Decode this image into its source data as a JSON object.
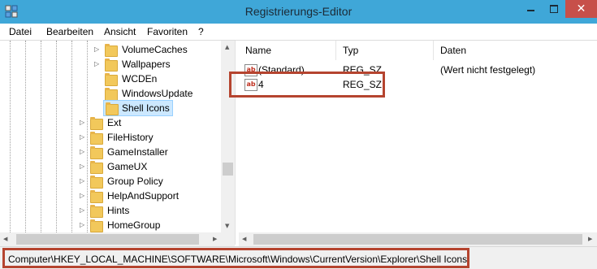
{
  "window": {
    "title": "Registrierungs-Editor",
    "close_glyph": "✕"
  },
  "menu": [
    "Datei",
    "Bearbeiten",
    "Ansicht",
    "Favoriten",
    "?"
  ],
  "tree": [
    {
      "label": "VolumeCaches",
      "expander": "▷"
    },
    {
      "label": "Wallpapers",
      "expander": "▷"
    },
    {
      "label": "WCDEn",
      "expander": ""
    },
    {
      "label": "WindowsUpdate",
      "expander": ""
    },
    {
      "label": "Shell Icons",
      "expander": "",
      "selected": true
    },
    {
      "label": "Ext",
      "expander": "▷"
    },
    {
      "label": "FileHistory",
      "expander": "▷"
    },
    {
      "label": "GameInstaller",
      "expander": "▷"
    },
    {
      "label": "GameUX",
      "expander": "▷"
    },
    {
      "label": "Group Policy",
      "expander": "▷"
    },
    {
      "label": "HelpAndSupport",
      "expander": "▷"
    },
    {
      "label": "Hints",
      "expander": "▷"
    },
    {
      "label": "HomeGroup",
      "expander": "▷"
    }
  ],
  "columns": [
    "Name",
    "Typ",
    "Daten"
  ],
  "values": [
    {
      "name": "(Standard)",
      "type": "REG_SZ",
      "data": "(Wert nicht festgelegt)",
      "icon": "ab"
    },
    {
      "name": "4",
      "type": "REG_SZ",
      "data": "",
      "icon": "ab"
    }
  ],
  "status": "Computer\\HKEY_LOCAL_MACHINE\\SOFTWARE\\Microsoft\\Windows\\CurrentVersion\\Explorer\\Shell Icons",
  "colors": {
    "titlebar": "#3fa7d8",
    "highlight": "#b5442f",
    "selection": "#cce8ff"
  }
}
